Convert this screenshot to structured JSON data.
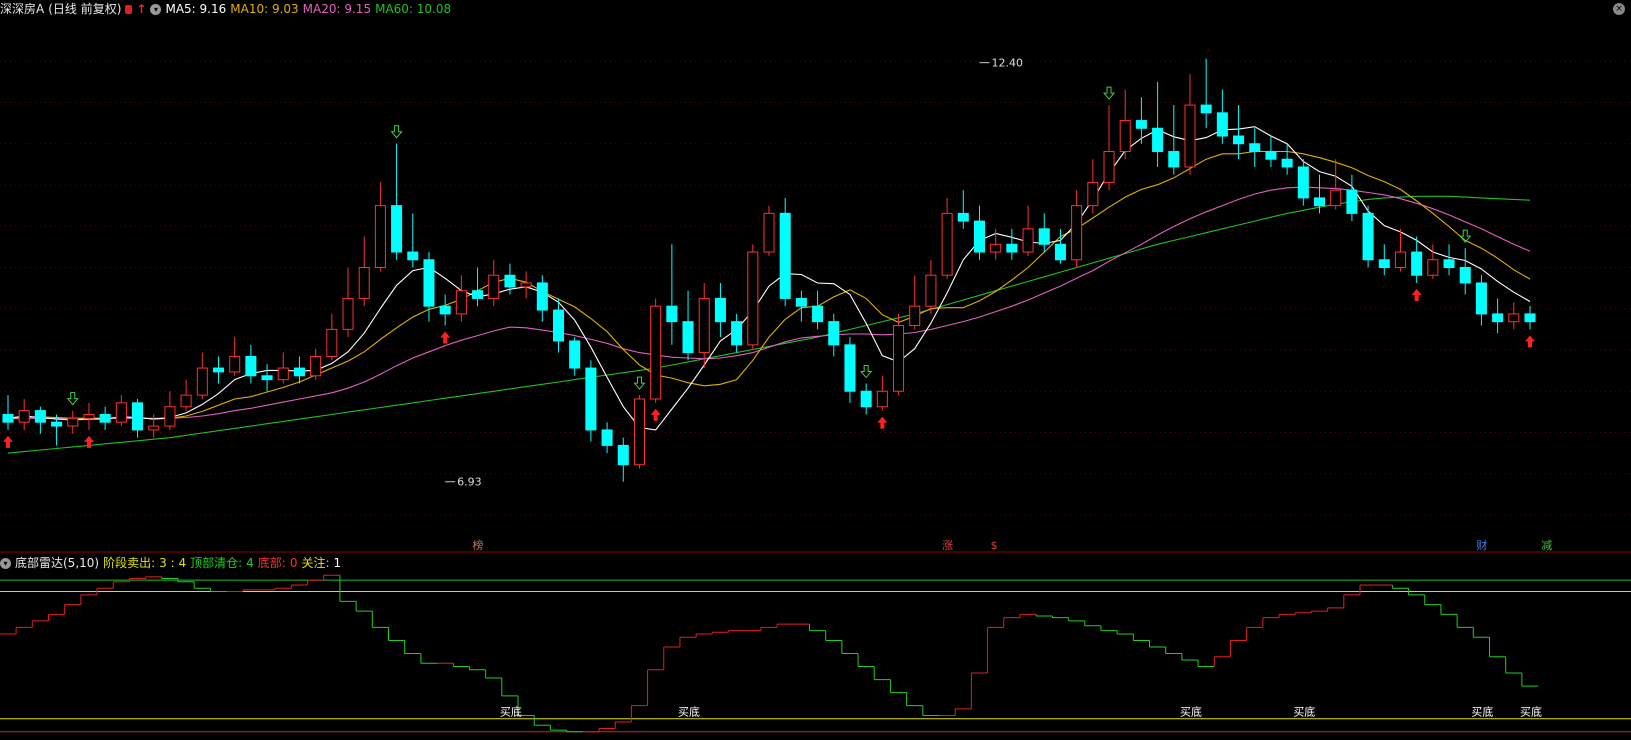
{
  "header": {
    "stock_name": "深深房A",
    "period": "(日线 前复权)",
    "ma5_label": "MA5: 9.16",
    "ma10_label": "MA10: 9.03",
    "ma20_label": "MA20: 9.15",
    "ma60_label": "MA60: 10.08",
    "colors": {
      "ma5": "#ffffff",
      "ma10": "#e0b000",
      "ma20": "#e060c0",
      "ma60": "#20c020"
    }
  },
  "sub_header": {
    "indicator": "底部雷达(5,10)",
    "stage_sell_label": "阶段卖出:",
    "stage_sell_value": "3 : 4",
    "top_clear_label": "顶部清仓:",
    "top_clear_value": "4",
    "bottom_label": "底部:",
    "bottom_value": "0",
    "watch_label": "关注:",
    "watch_value": "1"
  },
  "event_markers": [
    {
      "text": "榜",
      "color": "#c07060",
      "index": 29
    },
    {
      "text": "涨",
      "color": "#e04040",
      "index": 58
    },
    {
      "text": "$",
      "color": "#e04040",
      "index": 61
    },
    {
      "text": "财",
      "color": "#4080e0",
      "index": 91
    },
    {
      "text": "减",
      "color": "#40c040",
      "index": 95
    }
  ],
  "chart_data": [
    {
      "type": "candlestick",
      "title": "深深房A (日线 前复权)",
      "bull_color": "#ff3030",
      "bear_color": "#00ffff",
      "ylim": [
        6.5,
        12.9
      ],
      "annotations": [
        {
          "text": "12.40",
          "index": 60,
          "value": 12.4,
          "kind": "high"
        },
        {
          "text": "6.93",
          "index": 27,
          "value": 6.93,
          "kind": "low"
        }
      ],
      "candles": [
        [
          7.8,
          7.7,
          8.05,
          7.6
        ],
        [
          7.7,
          7.85,
          8.0,
          7.6
        ],
        [
          7.85,
          7.7,
          7.9,
          7.55
        ],
        [
          7.7,
          7.65,
          7.8,
          7.4
        ],
        [
          7.65,
          7.75,
          7.85,
          7.55
        ],
        [
          7.75,
          7.8,
          7.95,
          7.6
        ],
        [
          7.8,
          7.7,
          7.9,
          7.6
        ],
        [
          7.7,
          7.95,
          8.05,
          7.65
        ],
        [
          7.95,
          7.6,
          8.0,
          7.5
        ],
        [
          7.6,
          7.65,
          7.8,
          7.5
        ],
        [
          7.65,
          7.9,
          8.1,
          7.6
        ],
        [
          7.9,
          8.05,
          8.25,
          7.85
        ],
        [
          8.05,
          8.4,
          8.6,
          8.0
        ],
        [
          8.4,
          8.35,
          8.55,
          8.2
        ],
        [
          8.35,
          8.55,
          8.8,
          8.3
        ],
        [
          8.55,
          8.3,
          8.7,
          8.2
        ],
        [
          8.3,
          8.25,
          8.45,
          8.1
        ],
        [
          8.25,
          8.4,
          8.6,
          8.2
        ],
        [
          8.4,
          8.3,
          8.55,
          8.2
        ],
        [
          8.3,
          8.55,
          8.65,
          8.25
        ],
        [
          8.55,
          8.9,
          9.1,
          8.5
        ],
        [
          8.9,
          9.3,
          9.7,
          8.8
        ],
        [
          9.3,
          9.7,
          10.1,
          9.2
        ],
        [
          9.7,
          10.5,
          10.8,
          9.65
        ],
        [
          10.5,
          9.9,
          11.3,
          9.8
        ],
        [
          9.9,
          9.8,
          10.4,
          9.7
        ],
        [
          9.8,
          9.2,
          9.9,
          9.0
        ],
        [
          9.2,
          9.1,
          9.35,
          8.95
        ],
        [
          9.1,
          9.4,
          9.6,
          9.0
        ],
        [
          9.4,
          9.3,
          9.7,
          9.2
        ],
        [
          9.3,
          9.6,
          9.8,
          9.2
        ],
        [
          9.6,
          9.45,
          9.75,
          9.35
        ],
        [
          9.45,
          9.5,
          9.65,
          9.3
        ],
        [
          9.5,
          9.15,
          9.6,
          9.0
        ],
        [
          9.15,
          8.75,
          9.3,
          8.6
        ],
        [
          8.75,
          8.4,
          8.8,
          8.3
        ],
        [
          8.4,
          7.6,
          8.5,
          7.45
        ],
        [
          7.6,
          7.4,
          7.7,
          7.3
        ],
        [
          7.4,
          7.15,
          7.5,
          6.93
        ],
        [
          7.15,
          8.0,
          8.05,
          7.1
        ],
        [
          8.0,
          9.2,
          9.3,
          7.95
        ],
        [
          9.2,
          9.0,
          10.0,
          8.7
        ],
        [
          9.0,
          8.6,
          9.4,
          8.5
        ],
        [
          8.6,
          9.3,
          9.5,
          8.4
        ],
        [
          9.3,
          9.0,
          9.5,
          8.8
        ],
        [
          9.0,
          8.7,
          9.1,
          8.6
        ],
        [
          8.7,
          9.9,
          10.0,
          8.65
        ],
        [
          9.9,
          10.4,
          10.5,
          9.85
        ],
        [
          10.4,
          9.3,
          10.6,
          9.2
        ],
        [
          9.3,
          9.2,
          9.4,
          9.0
        ],
        [
          9.2,
          9.0,
          9.4,
          8.9
        ],
        [
          9.0,
          8.7,
          9.1,
          8.55
        ],
        [
          8.7,
          8.1,
          8.8,
          7.95
        ],
        [
          8.1,
          7.9,
          8.2,
          7.8
        ],
        [
          7.9,
          8.1,
          8.3,
          7.85
        ],
        [
          8.1,
          8.95,
          9.1,
          8.05
        ],
        [
          8.95,
          9.2,
          9.6,
          8.9
        ],
        [
          9.2,
          9.6,
          9.8,
          9.1
        ],
        [
          9.6,
          10.4,
          10.6,
          9.55
        ],
        [
          10.4,
          10.3,
          10.7,
          10.2
        ],
        [
          10.3,
          9.9,
          10.5,
          9.8
        ],
        [
          9.9,
          10.0,
          10.2,
          9.8
        ],
        [
          10.0,
          9.9,
          10.2,
          9.8
        ],
        [
          9.9,
          10.2,
          10.5,
          9.85
        ],
        [
          10.2,
          10.0,
          10.4,
          9.9
        ],
        [
          10.0,
          9.8,
          10.2,
          9.75
        ],
        [
          9.8,
          10.5,
          10.7,
          9.7
        ],
        [
          10.5,
          10.8,
          11.1,
          10.4
        ],
        [
          10.8,
          11.2,
          11.8,
          10.7
        ],
        [
          11.2,
          11.6,
          12.0,
          11.1
        ],
        [
          11.6,
          11.5,
          11.9,
          11.3
        ],
        [
          11.5,
          11.2,
          12.1,
          11.0
        ],
        [
          11.2,
          11.0,
          11.8,
          10.9
        ],
        [
          11.0,
          11.8,
          12.2,
          10.9
        ],
        [
          11.8,
          11.7,
          12.4,
          11.5
        ],
        [
          11.7,
          11.4,
          12.0,
          11.3
        ],
        [
          11.4,
          11.3,
          11.8,
          11.1
        ],
        [
          11.3,
          11.2,
          11.5,
          11.0
        ],
        [
          11.2,
          11.1,
          11.4,
          11.0
        ],
        [
          11.1,
          11.0,
          11.3,
          10.9
        ],
        [
          11.0,
          10.6,
          11.1,
          10.5
        ],
        [
          10.6,
          10.5,
          10.9,
          10.4
        ],
        [
          10.5,
          10.7,
          11.1,
          10.45
        ],
        [
          10.7,
          10.4,
          10.9,
          10.3
        ],
        [
          10.4,
          9.8,
          10.5,
          9.7
        ],
        [
          9.8,
          9.7,
          10.0,
          9.6
        ],
        [
          9.7,
          9.9,
          10.2,
          9.65
        ],
        [
          9.9,
          9.6,
          10.1,
          9.5
        ],
        [
          9.6,
          9.8,
          10.0,
          9.55
        ],
        [
          9.8,
          9.7,
          10.0,
          9.6
        ],
        [
          9.7,
          9.5,
          9.95,
          9.35
        ],
        [
          9.5,
          9.1,
          9.6,
          8.95
        ],
        [
          9.1,
          9.0,
          9.3,
          8.85
        ],
        [
          9.0,
          9.1,
          9.25,
          8.9
        ],
        [
          9.1,
          9.0,
          9.2,
          8.9
        ]
      ],
      "ma5": [
        7.75,
        7.78,
        7.76,
        7.74,
        7.73,
        7.74,
        7.74,
        7.77,
        7.76,
        7.74,
        7.76,
        7.82,
        7.93,
        8.07,
        8.25,
        8.33,
        8.37,
        8.37,
        8.36,
        8.37,
        8.46,
        8.61,
        8.85,
        9.17,
        9.47,
        9.66,
        9.7,
        9.56,
        9.4,
        9.32,
        9.36,
        9.42,
        9.45,
        9.38,
        9.25,
        9.02,
        8.67,
        8.28,
        7.9,
        7.63,
        7.6,
        7.87,
        8.14,
        8.44,
        8.75,
        8.9,
        9.14,
        9.46,
        9.62,
        9.61,
        9.5,
        9.49,
        9.35,
        8.98,
        8.56,
        8.48,
        8.65,
        8.98,
        9.37,
        9.8,
        10.05,
        10.14,
        10.09,
        10.03,
        10.01,
        10.05,
        10.27,
        10.58,
        10.92,
        11.21,
        11.37,
        11.48,
        11.39,
        11.34,
        11.38,
        11.48,
        11.49,
        11.52,
        11.4,
        11.3,
        11.07,
        10.94,
        10.88,
        10.75,
        10.43,
        10.24,
        10.16,
        10.05,
        9.9,
        9.83,
        9.79,
        9.68,
        9.52,
        9.38,
        9.26
      ],
      "ma10": [
        7.75,
        7.76,
        7.77,
        7.76,
        7.75,
        7.75,
        7.75,
        7.76,
        7.76,
        7.74,
        7.75,
        7.78,
        7.84,
        7.92,
        8.0,
        8.03,
        8.09,
        8.15,
        8.22,
        8.31,
        8.4,
        8.49,
        8.61,
        8.77,
        8.92,
        9.06,
        9.16,
        9.21,
        9.29,
        9.4,
        9.51,
        9.56,
        9.51,
        9.39,
        9.29,
        9.19,
        9.04,
        8.87,
        8.64,
        8.44,
        8.31,
        8.27,
        8.21,
        8.17,
        8.19,
        8.25,
        8.5,
        8.8,
        9.03,
        9.18,
        9.2,
        9.32,
        9.41,
        9.3,
        9.09,
        8.99,
        9.07,
        9.17,
        9.18,
        9.18,
        9.27,
        9.39,
        9.54,
        9.7,
        9.9,
        10.1,
        10.2,
        10.34,
        10.48,
        10.61,
        10.71,
        10.77,
        10.86,
        10.98,
        11.1,
        11.17,
        11.17,
        11.2,
        11.2,
        11.2,
        11.17,
        11.12,
        11.06,
        10.99,
        10.89,
        10.81,
        10.71,
        10.56,
        10.4,
        10.23,
        10.05,
        9.95,
        9.82,
        9.67,
        9.55
      ],
      "ma20": [
        7.74,
        7.75,
        7.75,
        7.75,
        7.75,
        7.75,
        7.75,
        7.75,
        7.75,
        7.75,
        7.75,
        7.76,
        7.78,
        7.81,
        7.85,
        7.88,
        7.92,
        7.96,
        8.0,
        8.04,
        8.08,
        8.14,
        8.22,
        8.32,
        8.43,
        8.53,
        8.61,
        8.69,
        8.76,
        8.82,
        8.88,
        8.93,
        8.92,
        8.89,
        8.86,
        8.82,
        8.77,
        8.72,
        8.65,
        8.6,
        8.57,
        8.54,
        8.53,
        8.52,
        8.53,
        8.56,
        8.6,
        8.67,
        8.74,
        8.79,
        8.81,
        8.83,
        8.84,
        8.84,
        8.83,
        8.84,
        8.86,
        8.9,
        8.95,
        9.0,
        9.06,
        9.13,
        9.2,
        9.28,
        9.37,
        9.46,
        9.56,
        9.66,
        9.78,
        9.89,
        10.0,
        10.12,
        10.23,
        10.33,
        10.42,
        10.5,
        10.58,
        10.65,
        10.7,
        10.73,
        10.74,
        10.73,
        10.72,
        10.7,
        10.67,
        10.64,
        10.59,
        10.53,
        10.46,
        10.38,
        10.29,
        10.2,
        10.1,
        10.0,
        9.91
      ],
      "ma60": [
        7.3,
        7.32,
        7.34,
        7.36,
        7.38,
        7.4,
        7.42,
        7.44,
        7.46,
        7.48,
        7.5,
        7.53,
        7.56,
        7.59,
        7.62,
        7.65,
        7.68,
        7.71,
        7.74,
        7.77,
        7.8,
        7.83,
        7.86,
        7.89,
        7.92,
        7.95,
        7.98,
        8.01,
        8.04,
        8.07,
        8.1,
        8.13,
        8.16,
        8.19,
        8.22,
        8.25,
        8.28,
        8.31,
        8.34,
        8.37,
        8.4,
        8.44,
        8.48,
        8.52,
        8.56,
        8.6,
        8.64,
        8.68,
        8.72,
        8.76,
        8.8,
        8.85,
        8.9,
        8.95,
        9.0,
        9.05,
        9.1,
        9.16,
        9.22,
        9.28,
        9.34,
        9.4,
        9.46,
        9.52,
        9.58,
        9.64,
        9.7,
        9.76,
        9.82,
        9.88,
        9.94,
        10.0,
        10.05,
        10.1,
        10.15,
        10.2,
        10.25,
        10.3,
        10.35,
        10.4,
        10.44,
        10.48,
        10.52,
        10.55,
        10.58,
        10.6,
        10.61,
        10.62,
        10.62,
        10.62,
        10.61,
        10.6,
        10.59,
        10.58,
        10.57
      ],
      "signals": [
        {
          "index": 0,
          "type": "buy"
        },
        {
          "index": 5,
          "type": "buy"
        },
        {
          "index": 4,
          "type": "sell"
        },
        {
          "index": 24,
          "type": "sell"
        },
        {
          "index": 27,
          "type": "buy"
        },
        {
          "index": 39,
          "type": "sell"
        },
        {
          "index": 40,
          "type": "buy"
        },
        {
          "index": 53,
          "type": "sell"
        },
        {
          "index": 54,
          "type": "buy"
        },
        {
          "index": 68,
          "type": "sell"
        },
        {
          "index": 87,
          "type": "buy"
        },
        {
          "index": 90,
          "type": "sell"
        },
        {
          "index": 94,
          "type": "buy"
        }
      ]
    },
    {
      "type": "step-line",
      "title": "底部雷达(5,10)",
      "ylim": [
        0,
        100
      ],
      "levels": [
        {
          "value": 95,
          "color": "#20c020"
        },
        {
          "value": 88,
          "color": "#e0e000"
        },
        {
          "value": 10,
          "color": "#e0e000"
        },
        {
          "value": 2,
          "color": "#e02020"
        }
      ],
      "values": [
        62,
        66,
        70,
        74,
        80,
        86,
        90,
        94,
        96,
        97,
        96,
        94,
        90,
        88,
        88,
        89,
        89,
        90,
        92,
        95,
        98,
        82,
        76,
        66,
        58,
        50,
        44,
        44,
        42,
        40,
        35,
        24,
        12,
        6,
        3,
        2,
        2,
        4,
        8,
        18,
        40,
        54,
        60,
        62,
        63,
        64,
        64,
        66,
        68,
        68,
        64,
        58,
        50,
        42,
        34,
        26,
        18,
        12,
        12,
        16,
        38,
        66,
        72,
        74,
        73,
        72,
        70,
        67,
        64,
        62,
        58,
        54,
        50,
        46,
        42,
        48,
        58,
        66,
        72,
        74,
        75,
        76,
        78,
        86,
        92,
        92,
        90,
        86,
        80,
        74,
        66,
        60,
        48,
        38,
        30
      ],
      "labels": [
        {
          "text": "买底",
          "index": 31
        },
        {
          "text": "买底",
          "index": 42
        },
        {
          "text": "买底",
          "index": 73
        },
        {
          "text": "买底",
          "index": 80
        },
        {
          "text": "买底",
          "index": 91
        },
        {
          "text": "买底",
          "index": 94
        }
      ]
    }
  ]
}
